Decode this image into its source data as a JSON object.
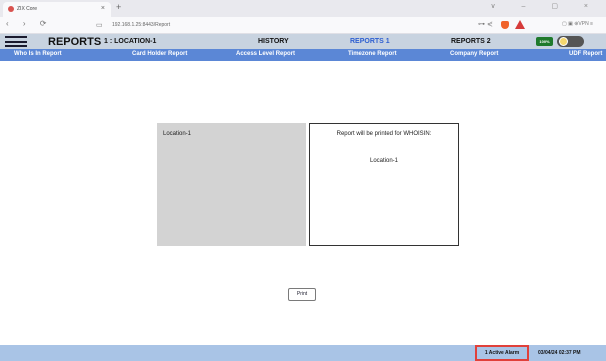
{
  "browser": {
    "tab_title": "ZIX Core",
    "tab_close": "×",
    "new_tab": "+",
    "window_controls": "∨ – ▢ ×",
    "url": "192.168.1.25:8443/Report",
    "nav_glyphs": "‹ › ⟳",
    "bookmark_glyph": "▭",
    "url_right_glyphs": "⊶ ⋞",
    "tools_right": "▢ ▣ ⊕VPN ≡"
  },
  "header": {
    "app_title": "REPORTS",
    "location_title": "1 : LOCATION-1",
    "menu": {
      "history": "HISTORY",
      "reports1": "REPORTS 1",
      "reports2": "REPORTS 2"
    },
    "battery_badge": "100%",
    "accent_color": "#2d5fd1"
  },
  "subnav": {
    "who_is_in": "Who Is In Report",
    "card_holder": "Card Holder Report",
    "access_level": "Access Level Report",
    "timezone": "Timezone Report",
    "company": "Company Report",
    "udf": "UDF Report"
  },
  "content": {
    "location_panel_label": "Location-1",
    "report_heading": "Report will be printed for WHOISIN:",
    "report_location": "Location-1",
    "print_label": "Print"
  },
  "footer": {
    "alarm_label": "1 Active Alarm",
    "datetime": "03/04/24 02:37 PM"
  }
}
